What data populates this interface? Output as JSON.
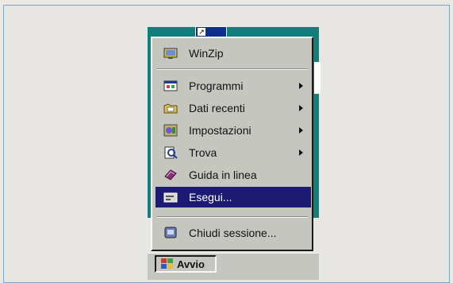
{
  "start_menu": {
    "items": [
      {
        "label": "WinZip",
        "icon": "winzip-icon",
        "submenu": false,
        "selected": false
      },
      {
        "label": "Programmi",
        "icon": "programs-icon",
        "submenu": true,
        "selected": false
      },
      {
        "label": "Dati recenti",
        "icon": "documents-icon",
        "submenu": true,
        "selected": false
      },
      {
        "label": "Impostazioni",
        "icon": "settings-icon",
        "submenu": true,
        "selected": false
      },
      {
        "label": "Trova",
        "icon": "find-icon",
        "submenu": true,
        "selected": false
      },
      {
        "label": "Guida in linea",
        "icon": "help-icon",
        "submenu": false,
        "selected": false
      },
      {
        "label": "Esegui...",
        "icon": "run-icon",
        "submenu": false,
        "selected": true
      },
      {
        "label": "Chiudi sessione...",
        "icon": "logoff-icon",
        "submenu": false,
        "selected": false
      }
    ]
  },
  "taskbar": {
    "start_label": "Avvio"
  },
  "colors": {
    "menu_bg": "#c6c6c1",
    "selection": "#1d1a74",
    "desktop": "#0f7f7c"
  }
}
